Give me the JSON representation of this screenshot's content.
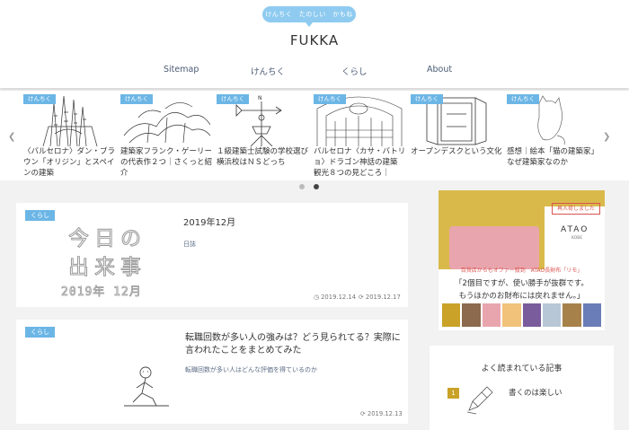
{
  "header": {
    "tagline": "けんちく　たのしい　かもね",
    "site_title": "FUKKA",
    "nav": [
      {
        "label": "Sitemap"
      },
      {
        "label": "けんちく"
      },
      {
        "label": "くらし"
      },
      {
        "label": "About"
      }
    ]
  },
  "carousel": {
    "slides": [
      {
        "category": "けんちく",
        "title": "〈バルセロナ〉ダン・ブラウン「オリジン」とスペインの建築"
      },
      {
        "category": "けんちく",
        "title": "建築家フランク・ゲーリーの代表作２つ｜さくっと紹介"
      },
      {
        "category": "けんちく",
        "title": "１級建築士試験の学校選び 横浜校はＮＳどっち"
      },
      {
        "category": "けんちく",
        "title": "バルセロナ〈カサ・バトリョ〉ドラゴン神話の建築 観光８つの見どころ｜"
      },
      {
        "category": "けんちく",
        "title": "オープンデスクという文化"
      },
      {
        "category": "けんちく",
        "title": "感想｜絵本「猫の建築家」なぜ建築家なのか"
      }
    ]
  },
  "posts": [
    {
      "category": "くらし",
      "thumb_text_line1": "今日の",
      "thumb_text_line2": "出来事",
      "thumb_text_line3": "2019年 12月",
      "title": "2019年12月",
      "excerpt": "日誌",
      "published": "2019.12.14",
      "updated": "2019.12.17"
    },
    {
      "category": "くらし",
      "title": "転職回数が多い人の強みは？どう見られてる？実際に言われたことをまとめてみた",
      "excerpt": "転職回数が多い人はどんな評価を得ているのか",
      "updated": "2019.12.13"
    }
  ],
  "ad": {
    "button": "再入荷しました",
    "brand": "ATAO",
    "brand_sub": "KOBE",
    "banner": "百貨店からもオファー殺到　ATAO長財布「リモ」",
    "copy_line1": "「2個目ですが、使い勝手が抜群です。",
    "copy_line2": "もうほかのお財布には戻れません。」"
  },
  "popular": {
    "heading": "よく読まれている記事",
    "items": [
      {
        "rank": "1",
        "title": "書くのは楽しい"
      }
    ]
  },
  "colors": {
    "accent": "#6cb6e6",
    "tagline_bg": "#8fcbf0",
    "rank_gold": "#c9a227"
  }
}
